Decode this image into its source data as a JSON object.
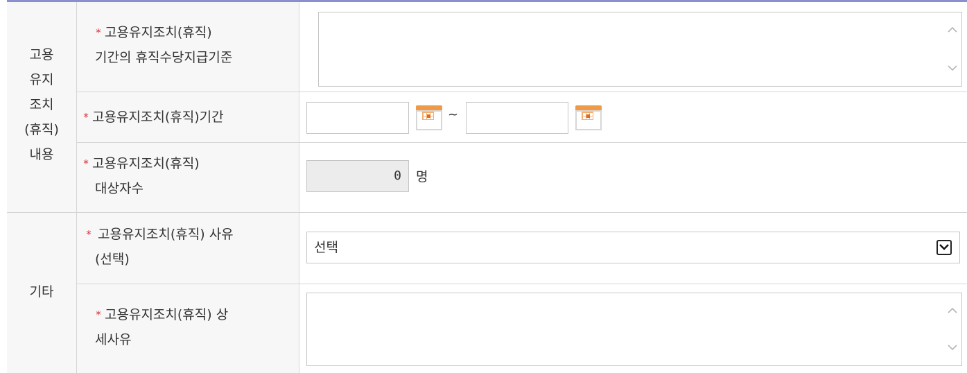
{
  "section_employment": {
    "label_lines": [
      "고용",
      "유지",
      "조치",
      "(휴직)",
      "내용"
    ]
  },
  "section_other": {
    "label": "기타"
  },
  "required_mark": "*",
  "row_allowance_criteria": {
    "label_lines": [
      "고용유지조치(휴직)",
      "기간의 휴직수당지급기준"
    ],
    "value": ""
  },
  "row_period": {
    "label": "고용유지조치(휴직)기간",
    "start_value": "",
    "end_value": "",
    "separator": "~"
  },
  "row_target_count": {
    "label_lines": [
      "고용유지조치(휴직)",
      "대상자수"
    ],
    "value": "0",
    "unit": "명"
  },
  "row_reason": {
    "label_lines": [
      "고용유지조치(휴직) 사유",
      "(선택)"
    ],
    "selected": "선택"
  },
  "row_detail_reason": {
    "label_lines": [
      "고용유지조치(휴직) 상",
      "세사유"
    ],
    "value": ""
  },
  "icons": {
    "calendar": "calendar-icon",
    "scroll_up": "chevron-up-icon",
    "scroll_down": "chevron-down-icon",
    "dropdown": "dropdown-arrow-icon"
  },
  "colors": {
    "required": "#d9303a",
    "header_line": "#8a8fd0",
    "label_bg": "#f7f7f7",
    "calendar_accent": "#f19a45"
  }
}
